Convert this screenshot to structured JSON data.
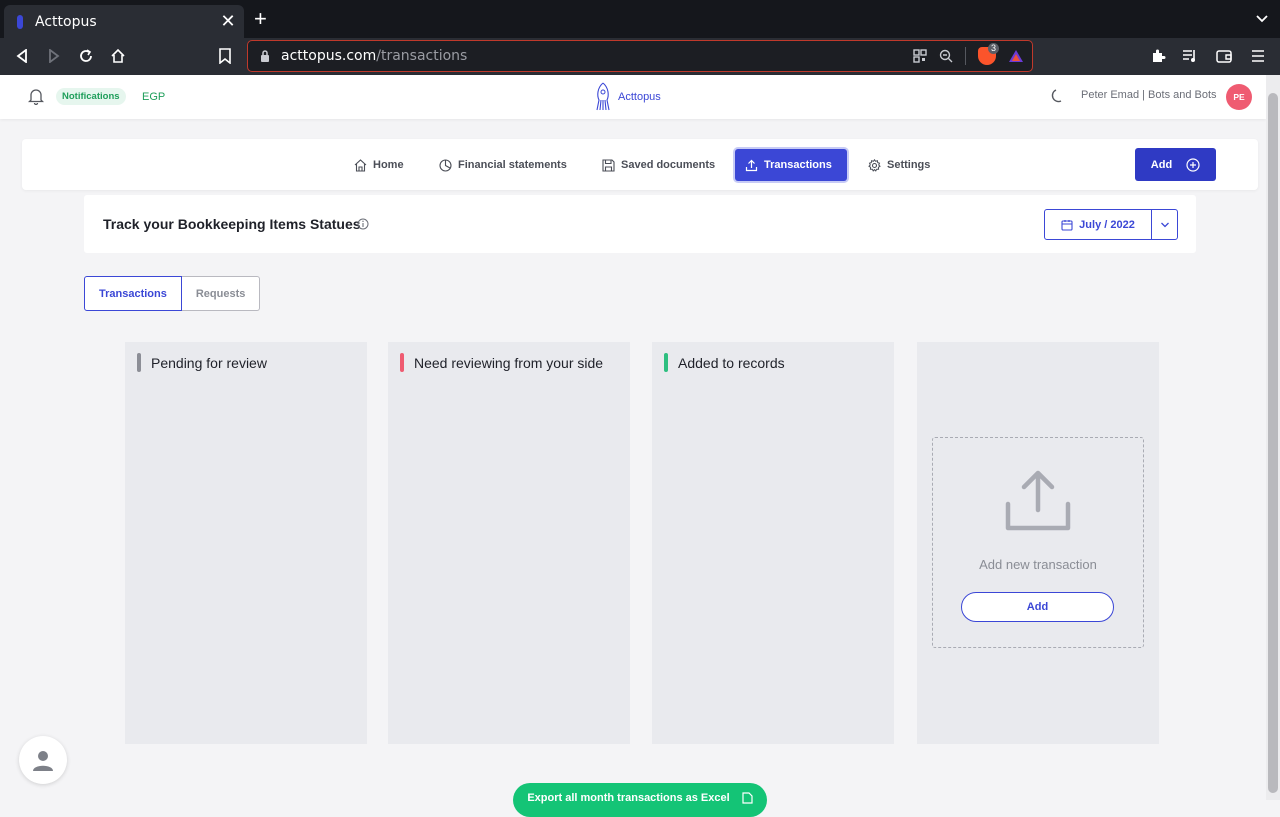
{
  "browser": {
    "tab_title": "Acttopus",
    "url_domain": "acttopus.com",
    "url_path": "/transactions",
    "shield_count": "3"
  },
  "header": {
    "notifications_label": "Notifications",
    "currency": "EGP",
    "logo_text": "Acttopus",
    "user_name": "Peter Emad | Bots and Bots",
    "avatar_initials": "PE"
  },
  "nav": {
    "items": [
      {
        "label": "Home",
        "icon": "home-icon"
      },
      {
        "label": "Financial statements",
        "icon": "pie-chart-icon"
      },
      {
        "label": "Saved documents",
        "icon": "save-icon"
      },
      {
        "label": "Transactions",
        "icon": "upload-icon",
        "active": true
      },
      {
        "label": "Settings",
        "icon": "gear-icon"
      }
    ],
    "add_label": "Add"
  },
  "track": {
    "title": "Track your Bookkeeping Items Statues",
    "date_label": "July / 2022"
  },
  "segments": {
    "transactions": "Transactions",
    "requests": "Requests"
  },
  "columns": [
    {
      "title": "Pending for review",
      "color": "#8c8e96"
    },
    {
      "title": "Need reviewing from your side",
      "color": "#ef5b71"
    },
    {
      "title": "Added to records",
      "color": "#2ebf80"
    }
  ],
  "upload": {
    "text": "Add new transaction",
    "add_label": "Add"
  },
  "footer": {
    "export_label": "Export all month transactions as Excel"
  },
  "colors": {
    "primary": "#3b47d6",
    "success": "#14c476",
    "avatar": "#ef5b71"
  }
}
